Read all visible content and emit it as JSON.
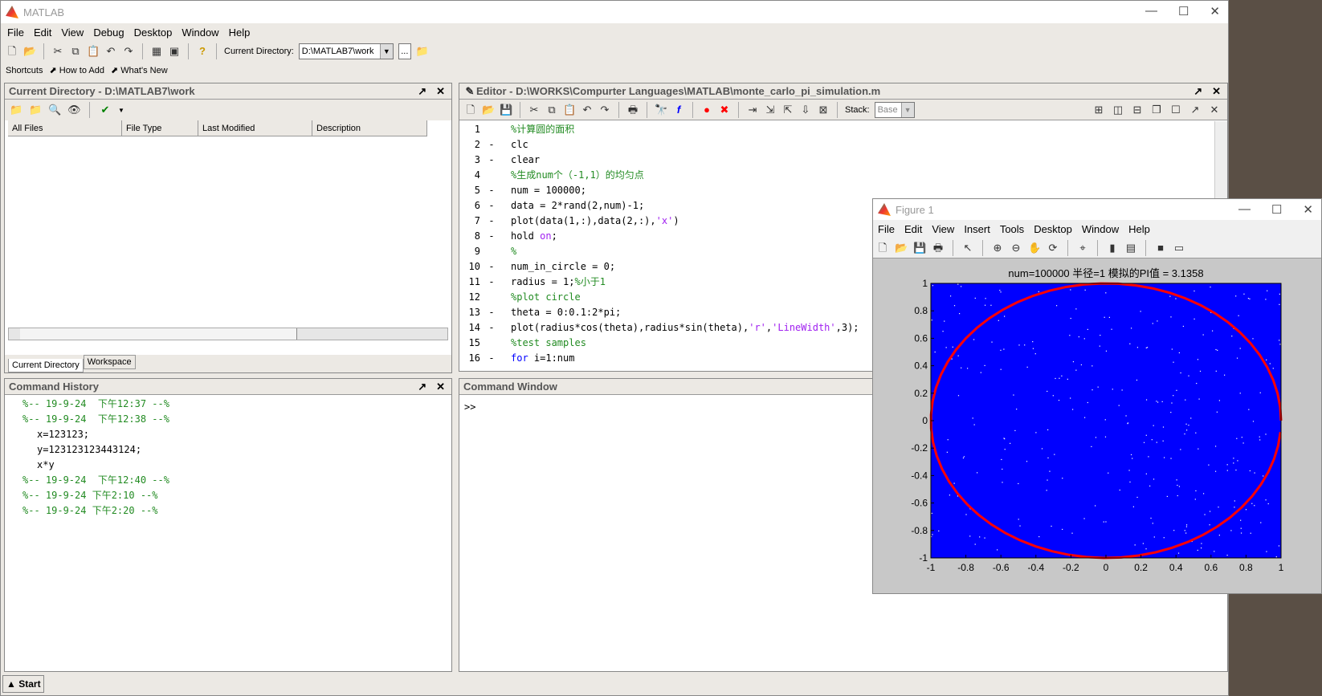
{
  "app": {
    "title": "MATLAB",
    "menu": [
      "File",
      "Edit",
      "View",
      "Debug",
      "Desktop",
      "Window",
      "Help"
    ],
    "toolbar": {
      "current_directory_label": "Current Directory:",
      "current_directory_value": "D:\\MATLAB7\\work",
      "browse": "..."
    },
    "shortcuts": {
      "label": "Shortcuts",
      "items": [
        "How to Add",
        "What's New"
      ]
    },
    "start_label": "Start"
  },
  "current_directory": {
    "title": "Current Directory - D:\\MATLAB7\\work",
    "columns": [
      "All Files",
      "File Type",
      "Last Modified",
      "Description"
    ],
    "tabs": [
      "Current Directory",
      "Workspace"
    ]
  },
  "command_history": {
    "title": "Command History",
    "entries": [
      {
        "text": "%-- 19-9-24  下午12:37 --%",
        "level": 0
      },
      {
        "text": "%-- 19-9-24  下午12:38 --%",
        "level": 0,
        "expanded": true
      },
      {
        "text": "x=123123;",
        "level": 1
      },
      {
        "text": "y=123123123443124;",
        "level": 1
      },
      {
        "text": "x*y",
        "level": 1
      },
      {
        "text": "%-- 19-9-24  下午12:40 --%",
        "level": 0
      },
      {
        "text": "%-- 19-9-24 下午2:10 --%",
        "level": 0
      },
      {
        "text": "%-- 19-9-24 下午2:20 --%",
        "level": 0
      }
    ]
  },
  "editor": {
    "title": "Editor - D:\\WORKS\\Compurter Languages\\MATLAB\\monte_carlo_pi_simulation.m",
    "stack_label": "Stack:",
    "stack_value": "Base",
    "lines": [
      {
        "n": "1",
        "bp": "",
        "parts": [
          [
            "%计算圆的面积",
            "green"
          ]
        ]
      },
      {
        "n": "2",
        "bp": "-",
        "parts": [
          [
            "clc",
            ""
          ]
        ]
      },
      {
        "n": "3",
        "bp": "-",
        "parts": [
          [
            "clear",
            ""
          ]
        ]
      },
      {
        "n": "4",
        "bp": "",
        "parts": [
          [
            "%生成num个（-1,1）的均匀点",
            "green"
          ]
        ]
      },
      {
        "n": "5",
        "bp": "-",
        "parts": [
          [
            "num = 100000;",
            ""
          ]
        ]
      },
      {
        "n": "6",
        "bp": "-",
        "parts": [
          [
            "data = 2*rand(2,num)-1;",
            ""
          ]
        ]
      },
      {
        "n": "7",
        "bp": "-",
        "parts": [
          [
            "plot(data(1,:),data(2,:),",
            ""
          ],
          [
            "'x'",
            "purple"
          ],
          [
            ")",
            ""
          ]
        ]
      },
      {
        "n": "8",
        "bp": "-",
        "parts": [
          [
            "hold ",
            ""
          ],
          [
            "on",
            "purple"
          ],
          [
            ";",
            ""
          ]
        ]
      },
      {
        "n": "9",
        "bp": "",
        "parts": [
          [
            "%",
            "green"
          ]
        ]
      },
      {
        "n": "10",
        "bp": "-",
        "parts": [
          [
            "num_in_circle = 0;",
            ""
          ]
        ]
      },
      {
        "n": "11",
        "bp": "-",
        "parts": [
          [
            "radius = 1;",
            ""
          ],
          [
            "%小于1",
            "green"
          ]
        ]
      },
      {
        "n": "12",
        "bp": "",
        "parts": [
          [
            "%plot circle",
            "green"
          ]
        ]
      },
      {
        "n": "13",
        "bp": "-",
        "parts": [
          [
            "theta = 0:0.1:2*pi;",
            ""
          ]
        ]
      },
      {
        "n": "14",
        "bp": "-",
        "parts": [
          [
            "plot(radius*cos(theta),radius*sin(theta),",
            ""
          ],
          [
            "'r'",
            "purple"
          ],
          [
            ",",
            ""
          ],
          [
            "'LineWidth'",
            "purple"
          ],
          [
            ",3);",
            ""
          ]
        ]
      },
      {
        "n": "15",
        "bp": "",
        "parts": [
          [
            "%test samples",
            "green"
          ]
        ]
      },
      {
        "n": "16",
        "bp": "-",
        "parts": [
          [
            "for",
            "blue"
          ],
          [
            " i=1:num",
            ""
          ]
        ]
      }
    ]
  },
  "command_window": {
    "title": "Command Window",
    "prompt": ">>"
  },
  "figure": {
    "title": "Figure 1",
    "menu": [
      "File",
      "Edit",
      "View",
      "Insert",
      "Tools",
      "Desktop",
      "Window",
      "Help"
    ]
  },
  "chart_data": {
    "type": "scatter",
    "title": "num=100000 半径=1 模拟的PI值 = 3.1358",
    "xlim": [
      -1,
      1
    ],
    "ylim": [
      -1,
      1
    ],
    "xticks": [
      "-1",
      "-0.8",
      "-0.6",
      "-0.4",
      "-0.2",
      "0",
      "0.2",
      "0.4",
      "0.6",
      "0.8",
      "1"
    ],
    "yticks": [
      "1",
      "0.8",
      "0.6",
      "0.4",
      "0.2",
      "0",
      "-0.2",
      "-0.4",
      "-0.6",
      "-0.8",
      "-1"
    ],
    "series": [
      {
        "type": "scatter",
        "marker": "x",
        "color": "#0000ff",
        "count": 100000,
        "distribution": "uniform on [-1,1]x[-1,1]"
      },
      {
        "type": "line",
        "color": "#ff0000",
        "shape": "circle",
        "radius": 1,
        "theta_step": 0.1,
        "line_width": 3
      }
    ],
    "colors": {
      "points": "#0000ff",
      "circle": "#ff0000",
      "background": "#c8c8c8"
    }
  }
}
